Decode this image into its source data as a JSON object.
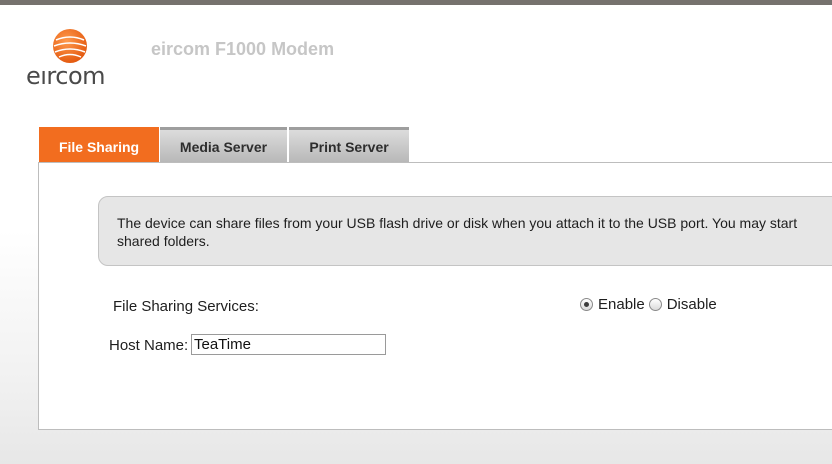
{
  "brand": {
    "logo_text": "eırcom",
    "accent_color": "#f26d1f"
  },
  "header": {
    "title": "eircom F1000 Modem"
  },
  "tabs": [
    {
      "label": "File Sharing",
      "active": true
    },
    {
      "label": "Media Server",
      "active": false
    },
    {
      "label": "Print Server",
      "active": false
    }
  ],
  "info": {
    "text_line1": "The device can share files from your USB flash drive or disk when you attach it to the USB port. You may start",
    "text_line2": "shared folders."
  },
  "file_sharing": {
    "label": "File Sharing Services:",
    "options": [
      {
        "label": "Enable",
        "selected": true
      },
      {
        "label": "Disable",
        "selected": false
      }
    ]
  },
  "host": {
    "label": "Host Name:",
    "value": "TeaTime"
  }
}
